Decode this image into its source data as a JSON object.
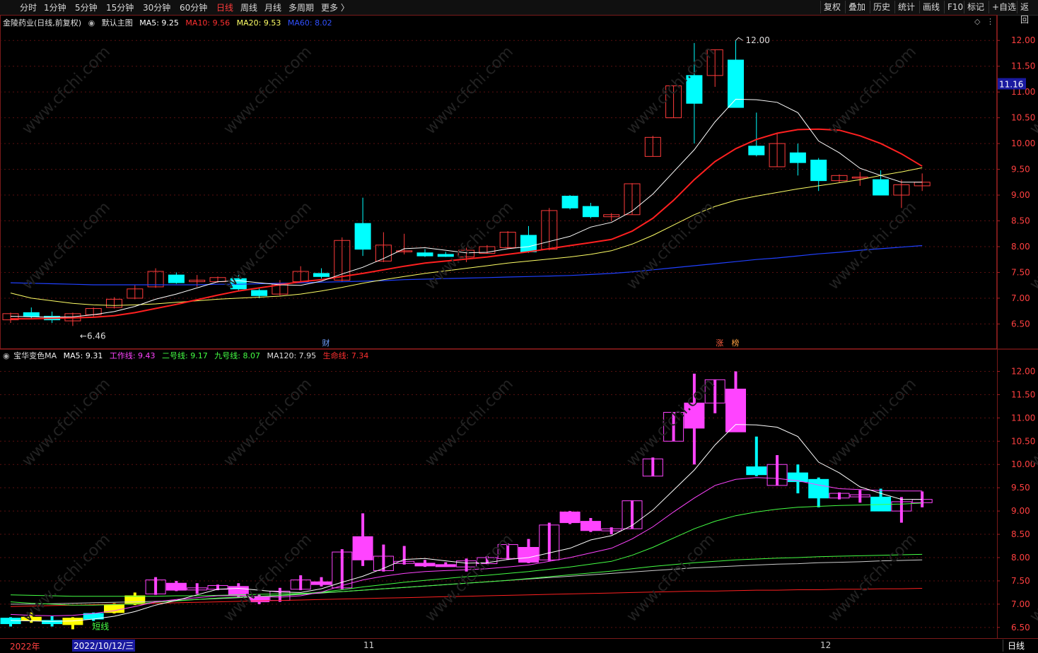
{
  "toolbar": {
    "periods": [
      "分时",
      "1分钟",
      "5分钟",
      "15分钟",
      "30分钟",
      "60分钟",
      "日线",
      "周线",
      "月线",
      "多周期",
      "更多 〉"
    ],
    "active_period": "日线",
    "right_buttons": [
      "复权",
      "叠加",
      "历史",
      "统计",
      "画线",
      "F10",
      "标记",
      "+自选",
      "返回"
    ]
  },
  "main_legend": {
    "stock": "金陵药业(日线,前复权)",
    "template": "默认主图",
    "ma5": "MA5: 9.25",
    "ma10": "MA10: 9.56",
    "ma20": "MA20: 9.53",
    "ma60": "MA60: 8.02"
  },
  "sub_legend": {
    "name": "宝华变色MA",
    "ma5": "MA5: 9.31",
    "work": "工作线: 9.43",
    "line2": "二号线: 9.17",
    "line9": "九号线: 8.07",
    "ma120": "MA120: 7.95",
    "life": "生命线: 7.34"
  },
  "annotations": {
    "high_label": "12.00",
    "low_label": "6.46",
    "price_badge": "11.16",
    "tag_cai": "财",
    "tag_zhang": "涨",
    "tag_bang": "榜",
    "short_line": "短线"
  },
  "bottom": {
    "year": "2022年",
    "cursor_date": "2022/10/12/三",
    "month_11": "11",
    "month_12": "12",
    "period": "日线"
  },
  "colors": {
    "up": "#ff3b3b",
    "down": "#00ffff",
    "ma5": "#ffffff",
    "ma10": "#ff2020",
    "ma20": "#ffff66",
    "ma60": "#2040ff",
    "work": "#ff44ff",
    "line2": "#44ff44",
    "line9": "#44ff44",
    "ma120": "#cccccc",
    "life": "#ff2020"
  },
  "chart_data": [
    {
      "type": "candlestick",
      "panel": "main",
      "y_ticks": [
        12.0,
        11.5,
        11.0,
        10.5,
        10.0,
        9.5,
        9.0,
        8.5,
        8.0,
        7.5,
        7.0,
        6.5
      ],
      "ylim": [
        6.3,
        12.25
      ],
      "candles": [
        {
          "o": 6.58,
          "h": 6.72,
          "l": 6.52,
          "c": 6.7
        },
        {
          "o": 6.72,
          "h": 6.82,
          "l": 6.6,
          "c": 6.65
        },
        {
          "o": 6.65,
          "h": 6.74,
          "l": 6.52,
          "c": 6.58
        },
        {
          "o": 6.56,
          "h": 6.72,
          "l": 6.46,
          "c": 6.7
        },
        {
          "o": 6.68,
          "h": 6.82,
          "l": 6.64,
          "c": 6.8
        },
        {
          "o": 6.82,
          "h": 7.02,
          "l": 6.8,
          "c": 6.98
        },
        {
          "o": 7.0,
          "h": 7.25,
          "l": 6.98,
          "c": 7.18
        },
        {
          "o": 7.22,
          "h": 7.58,
          "l": 7.2,
          "c": 7.52
        },
        {
          "o": 7.45,
          "h": 7.5,
          "l": 7.28,
          "c": 7.3
        },
        {
          "o": 7.32,
          "h": 7.45,
          "l": 7.22,
          "c": 7.35
        },
        {
          "o": 7.32,
          "h": 7.42,
          "l": 7.3,
          "c": 7.4
        },
        {
          "o": 7.38,
          "h": 7.45,
          "l": 7.15,
          "c": 7.18
        },
        {
          "o": 7.15,
          "h": 7.2,
          "l": 7.0,
          "c": 7.05
        },
        {
          "o": 7.08,
          "h": 7.35,
          "l": 7.05,
          "c": 7.28
        },
        {
          "o": 7.32,
          "h": 7.62,
          "l": 7.3,
          "c": 7.52
        },
        {
          "o": 7.48,
          "h": 7.58,
          "l": 7.38,
          "c": 7.42
        },
        {
          "o": 7.35,
          "h": 8.18,
          "l": 7.32,
          "c": 8.12
        },
        {
          "o": 8.45,
          "h": 8.95,
          "l": 7.82,
          "c": 7.95
        },
        {
          "o": 7.72,
          "h": 8.28,
          "l": 7.7,
          "c": 8.03
        },
        {
          "o": 7.9,
          "h": 8.25,
          "l": 7.85,
          "c": 7.92
        },
        {
          "o": 7.88,
          "h": 7.95,
          "l": 7.8,
          "c": 7.82
        },
        {
          "o": 7.85,
          "h": 7.9,
          "l": 7.8,
          "c": 7.81
        },
        {
          "o": 7.8,
          "h": 7.98,
          "l": 7.7,
          "c": 7.93
        },
        {
          "o": 7.87,
          "h": 8.03,
          "l": 7.86,
          "c": 8.0
        },
        {
          "o": 7.98,
          "h": 8.3,
          "l": 7.95,
          "c": 8.28
        },
        {
          "o": 8.22,
          "h": 8.4,
          "l": 7.88,
          "c": 7.9
        },
        {
          "o": 7.95,
          "h": 8.75,
          "l": 7.93,
          "c": 8.7
        },
        {
          "o": 8.98,
          "h": 9.0,
          "l": 8.72,
          "c": 8.75
        },
        {
          "o": 8.78,
          "h": 8.85,
          "l": 8.55,
          "c": 8.58
        },
        {
          "o": 8.58,
          "h": 8.65,
          "l": 8.5,
          "c": 8.62
        },
        {
          "o": 8.62,
          "h": 9.23,
          "l": 8.62,
          "c": 9.22
        },
        {
          "o": 9.75,
          "h": 10.15,
          "l": 9.75,
          "c": 10.12
        },
        {
          "o": 10.5,
          "h": 11.12,
          "l": 10.5,
          "c": 11.12
        },
        {
          "o": 11.32,
          "h": 11.95,
          "l": 10.0,
          "c": 10.78
        },
        {
          "o": 11.32,
          "h": 11.82,
          "l": 11.1,
          "c": 11.82
        },
        {
          "o": 11.62,
          "h": 12.0,
          "l": 10.7,
          "c": 10.7
        },
        {
          "o": 9.95,
          "h": 10.6,
          "l": 9.75,
          "c": 9.78
        },
        {
          "o": 9.55,
          "h": 10.2,
          "l": 9.55,
          "c": 10.0
        },
        {
          "o": 9.82,
          "h": 10.0,
          "l": 9.38,
          "c": 9.63
        },
        {
          "o": 9.68,
          "h": 9.72,
          "l": 9.08,
          "c": 9.28
        },
        {
          "o": 9.28,
          "h": 9.4,
          "l": 9.25,
          "c": 9.38
        },
        {
          "o": 9.35,
          "h": 9.45,
          "l": 9.18,
          "c": 9.35
        },
        {
          "o": 9.3,
          "h": 9.48,
          "l": 9.0,
          "c": 9.0
        },
        {
          "o": 9.0,
          "h": 9.3,
          "l": 8.75,
          "c": 9.2
        },
        {
          "o": 9.18,
          "h": 9.42,
          "l": 9.08,
          "c": 9.25
        }
      ],
      "ma5": [
        6.65,
        6.64,
        6.63,
        6.64,
        6.68,
        6.74,
        6.84,
        6.98,
        7.08,
        7.2,
        7.32,
        7.34,
        7.3,
        7.26,
        7.25,
        7.33,
        7.47,
        7.6,
        7.77,
        7.96,
        7.98,
        7.93,
        7.88,
        7.89,
        7.96,
        8.0,
        8.1,
        8.2,
        8.38,
        8.47,
        8.69,
        9.02,
        9.45,
        9.88,
        10.42,
        10.86,
        10.85,
        10.8,
        10.6,
        10.05,
        9.82,
        9.52,
        9.38,
        9.25,
        9.25
      ],
      "ma10": [
        6.6,
        6.6,
        6.61,
        6.62,
        6.63,
        6.66,
        6.72,
        6.8,
        6.88,
        6.97,
        7.06,
        7.14,
        7.2,
        7.26,
        7.32,
        7.36,
        7.42,
        7.48,
        7.55,
        7.62,
        7.68,
        7.72,
        7.76,
        7.8,
        7.85,
        7.9,
        7.96,
        8.02,
        8.08,
        8.14,
        8.3,
        8.55,
        8.9,
        9.3,
        9.65,
        9.9,
        10.08,
        10.2,
        10.27,
        10.28,
        10.26,
        10.15,
        10.0,
        9.8,
        9.56
      ],
      "ma20": [
        7.1,
        7.0,
        6.95,
        6.9,
        6.87,
        6.86,
        6.87,
        6.89,
        6.92,
        6.95,
        6.98,
        7.0,
        7.02,
        7.04,
        7.08,
        7.14,
        7.21,
        7.29,
        7.36,
        7.42,
        7.48,
        7.53,
        7.58,
        7.63,
        7.68,
        7.72,
        7.76,
        7.8,
        7.85,
        7.92,
        8.05,
        8.22,
        8.42,
        8.62,
        8.78,
        8.9,
        8.98,
        9.05,
        9.12,
        9.18,
        9.24,
        9.3,
        9.38,
        9.45,
        9.53
      ],
      "ma60": [
        7.3,
        7.29,
        7.28,
        7.27,
        7.26,
        7.26,
        7.26,
        7.26,
        7.26,
        7.26,
        7.27,
        7.27,
        7.28,
        7.29,
        7.3,
        7.31,
        7.32,
        7.33,
        7.34,
        7.36,
        7.37,
        7.38,
        7.39,
        7.4,
        7.41,
        7.42,
        7.43,
        7.44,
        7.46,
        7.48,
        7.51,
        7.55,
        7.59,
        7.63,
        7.67,
        7.71,
        7.75,
        7.78,
        7.82,
        7.86,
        7.89,
        7.93,
        7.96,
        7.99,
        8.02
      ]
    },
    {
      "type": "candlestick",
      "panel": "indicator",
      "y_ticks": [
        12.0,
        11.5,
        11.0,
        10.5,
        10.0,
        9.5,
        9.0,
        8.5,
        8.0,
        7.5,
        7.0,
        6.5
      ],
      "ylim": [
        6.3,
        12.25
      ],
      "work": [
        6.78,
        6.76,
        6.75,
        6.76,
        6.8,
        6.86,
        6.95,
        7.05,
        7.1,
        7.14,
        7.18,
        7.18,
        7.16,
        7.15,
        7.18,
        7.26,
        7.4,
        7.52,
        7.6,
        7.66,
        7.7,
        7.72,
        7.74,
        7.76,
        7.8,
        7.84,
        7.92,
        8.0,
        8.1,
        8.2,
        8.4,
        8.66,
        8.98,
        9.28,
        9.55,
        9.68,
        9.72,
        9.7,
        9.65,
        9.56,
        9.48,
        9.46,
        9.44,
        9.43,
        9.43
      ],
      "line2": [
        7.05,
        7.02,
        7.0,
        6.98,
        6.98,
        6.99,
        7.01,
        7.04,
        7.07,
        7.1,
        7.13,
        7.15,
        7.17,
        7.19,
        7.22,
        7.26,
        7.31,
        7.37,
        7.42,
        7.47,
        7.51,
        7.55,
        7.59,
        7.62,
        7.66,
        7.7,
        7.75,
        7.8,
        7.86,
        7.92,
        8.05,
        8.22,
        8.42,
        8.62,
        8.78,
        8.9,
        8.98,
        9.04,
        9.08,
        9.1,
        9.12,
        9.13,
        9.14,
        9.15,
        9.17
      ],
      "line9": [
        7.2,
        7.19,
        7.18,
        7.17,
        7.17,
        7.17,
        7.17,
        7.17,
        7.18,
        7.18,
        7.19,
        7.2,
        7.21,
        7.22,
        7.23,
        7.25,
        7.27,
        7.3,
        7.33,
        7.36,
        7.39,
        7.42,
        7.45,
        7.48,
        7.51,
        7.55,
        7.59,
        7.63,
        7.67,
        7.71,
        7.76,
        7.81,
        7.85,
        7.89,
        7.92,
        7.95,
        7.97,
        7.99,
        8.0,
        8.02,
        8.03,
        8.04,
        8.05,
        8.06,
        8.07
      ],
      "ma120": [
        7.0,
        7.0,
        7.01,
        7.02,
        7.03,
        7.04,
        7.05,
        7.06,
        7.08,
        7.1,
        7.12,
        7.14,
        7.16,
        7.18,
        7.21,
        7.24,
        7.27,
        7.3,
        7.33,
        7.36,
        7.39,
        7.42,
        7.45,
        7.48,
        7.51,
        7.54,
        7.57,
        7.6,
        7.63,
        7.66,
        7.69,
        7.72,
        7.75,
        7.78,
        7.8,
        7.82,
        7.84,
        7.86,
        7.87,
        7.89,
        7.9,
        7.91,
        7.93,
        7.94,
        7.95
      ],
      "life": [
        6.95,
        6.96,
        6.97,
        6.98,
        6.99,
        7.0,
        7.01,
        7.02,
        7.03,
        7.04,
        7.05,
        7.06,
        7.07,
        7.08,
        7.09,
        7.1,
        7.11,
        7.12,
        7.13,
        7.14,
        7.15,
        7.16,
        7.17,
        7.18,
        7.19,
        7.2,
        7.21,
        7.22,
        7.23,
        7.24,
        7.25,
        7.26,
        7.27,
        7.28,
        7.28,
        7.29,
        7.3,
        7.3,
        7.31,
        7.31,
        7.32,
        7.32,
        7.33,
        7.33,
        7.34
      ]
    }
  ]
}
